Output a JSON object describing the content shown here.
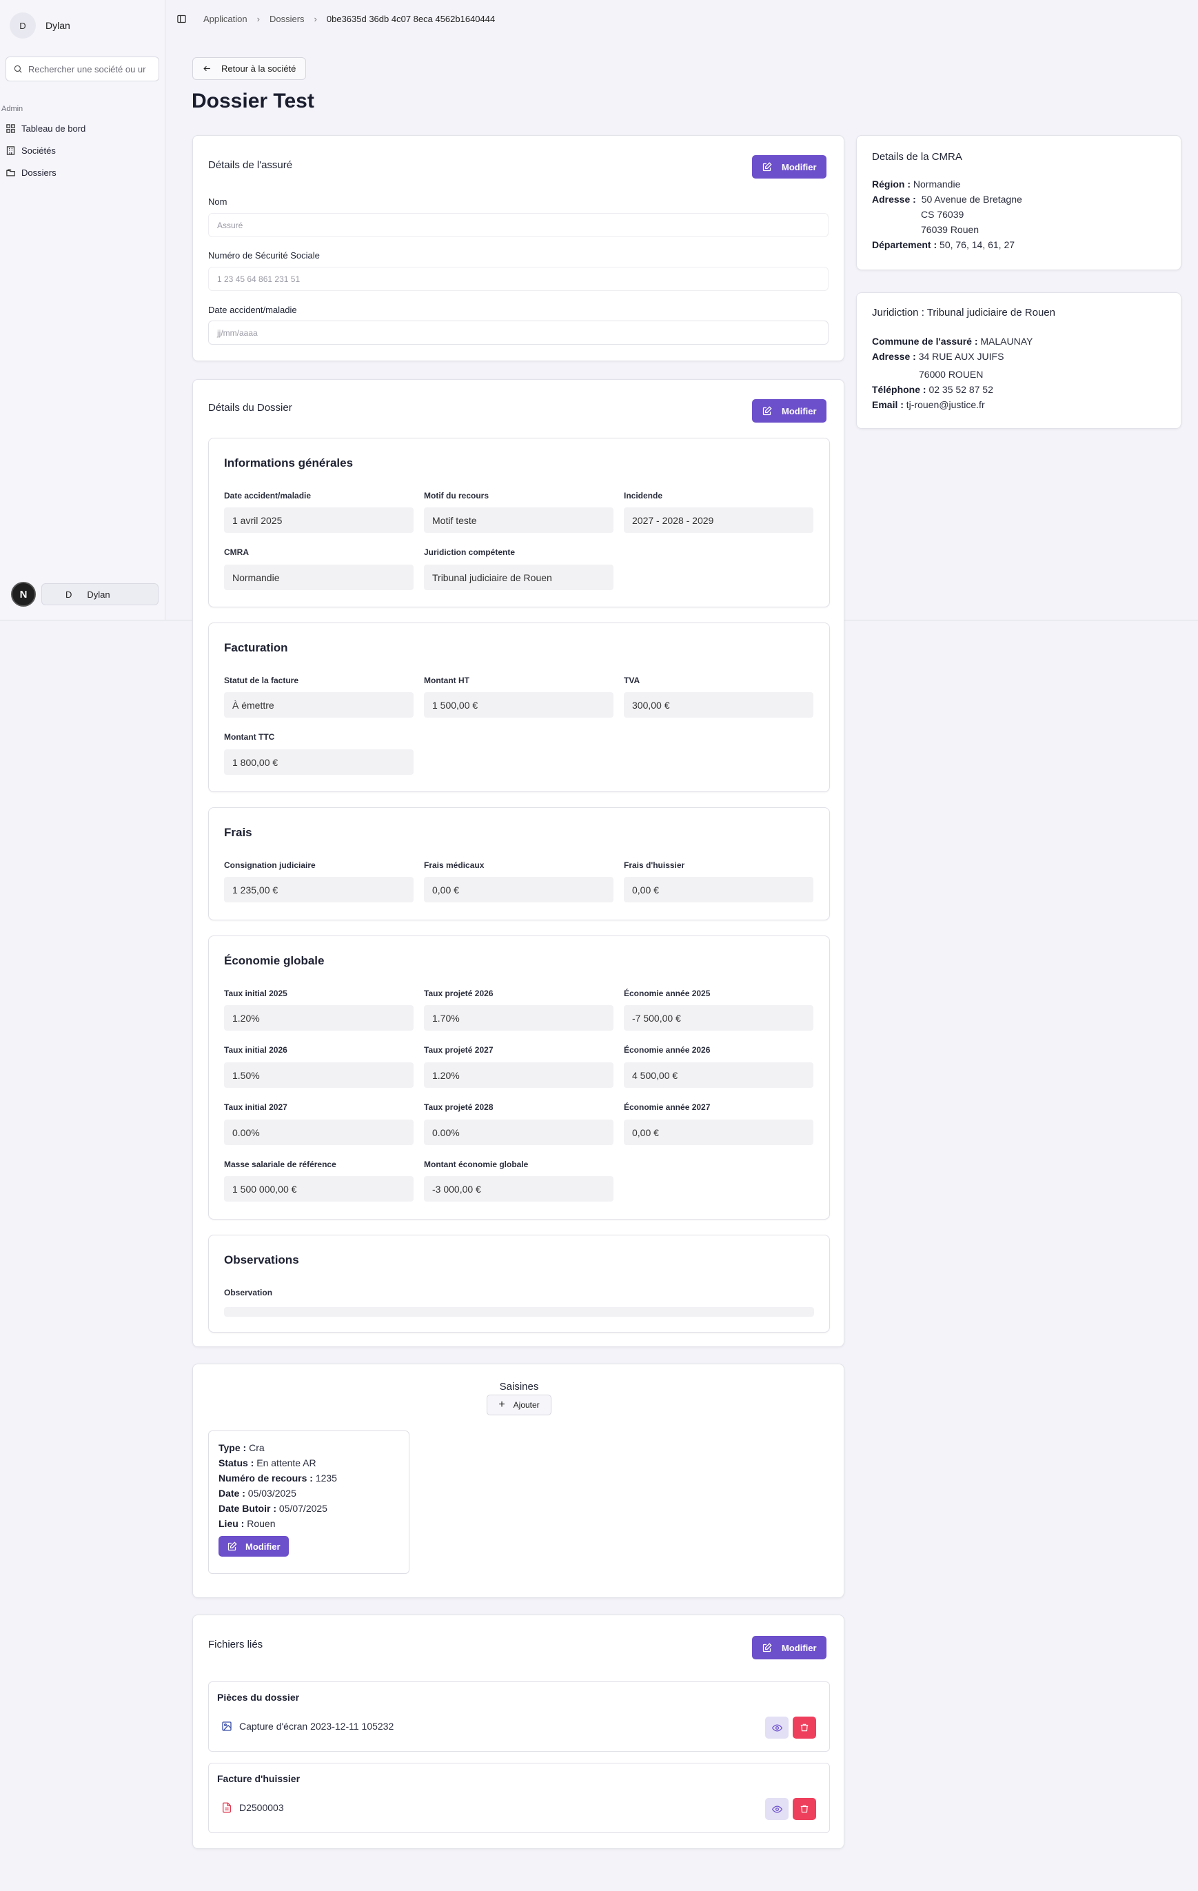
{
  "sidebar": {
    "user_initial": "D",
    "user_name": "Dylan",
    "search_placeholder": "Rechercher une société ou ur",
    "section_title": "Admin",
    "items": [
      {
        "label": "Tableau de bord",
        "icon": "dashboard-icon"
      },
      {
        "label": "Sociétés",
        "icon": "building-icon"
      },
      {
        "label": "Dossiers",
        "icon": "folders-icon"
      }
    ],
    "footer_badge": "N",
    "footer_initial": "D",
    "footer_name": "Dylan"
  },
  "breadcrumb": [
    "Application",
    "Dossiers",
    "0be3635d 36db 4c07 8eca 4562b1640444"
  ],
  "back_button": "Retour à la société",
  "page_title": "Dossier Test",
  "modify_label": "Modifier",
  "assure": {
    "title": "Détails de l'assuré",
    "fields": [
      {
        "label": "Nom",
        "placeholder": "Assuré"
      },
      {
        "label": "Numéro de Sécurité Sociale",
        "placeholder": "1 23 45 64 861 231 51"
      },
      {
        "label": "Date accident/maladie",
        "placeholder": "jj/mm/aaaa"
      }
    ]
  },
  "dossier": {
    "title": "Détails du Dossier",
    "generales": {
      "title": "Informations générales",
      "fields": [
        {
          "label": "Date accident/maladie",
          "value": "1 avril 2025"
        },
        {
          "label": "Motif du recours",
          "value": "Motif teste"
        },
        {
          "label": "Incidende",
          "value": "2027 - 2028 - 2029"
        },
        {
          "label": "CMRA",
          "value": "Normandie"
        },
        {
          "label": "Juridiction compétente",
          "value": "Tribunal judiciaire de Rouen"
        }
      ]
    },
    "facturation": {
      "title": "Facturation",
      "fields": [
        {
          "label": "Statut de la facture",
          "value": "À émettre"
        },
        {
          "label": "Montant HT",
          "value": "1 500,00 €"
        },
        {
          "label": "TVA",
          "value": "300,00 €"
        },
        {
          "label": "Montant TTC",
          "value": "1 800,00 €"
        }
      ]
    },
    "frais": {
      "title": "Frais",
      "fields": [
        {
          "label": "Consignation judiciaire",
          "value": "1 235,00 €"
        },
        {
          "label": "Frais médicaux",
          "value": "0,00 €"
        },
        {
          "label": "Frais d'huissier",
          "value": "0,00 €"
        }
      ]
    },
    "economie": {
      "title": "Économie globale",
      "fields": [
        {
          "label": "Taux initial 2025",
          "value": "1.20%"
        },
        {
          "label": "Taux projeté 2026",
          "value": "1.70%"
        },
        {
          "label": "Économie année 2025",
          "value": "-7 500,00 €"
        },
        {
          "label": "Taux initial 2026",
          "value": "1.50%"
        },
        {
          "label": "Taux projeté 2027",
          "value": "1.20%"
        },
        {
          "label": "Économie année 2026",
          "value": "4 500,00 €"
        },
        {
          "label": "Taux initial 2027",
          "value": "0.00%"
        },
        {
          "label": "Taux projeté 2028",
          "value": "0.00%"
        },
        {
          "label": "Économie année 2027",
          "value": "0,00 €"
        },
        {
          "label": "Masse salariale de référence",
          "value": "1 500 000,00 €"
        },
        {
          "label": "Montant économie globale",
          "value": "-3 000,00 €"
        }
      ]
    },
    "observations": {
      "title": "Observations",
      "label": "Observation",
      "value": ""
    }
  },
  "saisines": {
    "title": "Saisines",
    "add_label": "Ajouter",
    "item": {
      "type_label": "Type :",
      "type_value": "Cra",
      "status_label": "Status :",
      "status_value": "En attente AR",
      "numero_label": "Numéro de recours :",
      "numero_value": "1235",
      "date_label": "Date :",
      "date_value": "05/03/2025",
      "butoir_label": "Date Butoir :",
      "butoir_value": "05/07/2025",
      "lieu_label": "Lieu :",
      "lieu_value": "Rouen"
    }
  },
  "fichiers": {
    "title": "Fichiers liés",
    "groups": [
      {
        "title": "Pièces du dossier",
        "file": "Capture d'écran 2023-12-11 105232",
        "icon": "image-file-icon"
      },
      {
        "title": "Facture d'huissier",
        "file": "D2500003",
        "icon": "pdf-file-icon"
      }
    ]
  },
  "cmra": {
    "title": "Details de la CMRA",
    "region_label": "Région :",
    "region_value": "Normandie",
    "adresse_label": "Adresse :",
    "adresse_1": "50 Avenue de Bretagne",
    "adresse_2": "CS 76039",
    "adresse_3": "76039 Rouen",
    "dept_label": "Département :",
    "dept_value": "50, 76, 14, 61, 27"
  },
  "juridiction": {
    "title": "Juridiction : Tribunal judiciaire de Rouen",
    "commune_label": "Commune de l'assuré :",
    "commune_value": "MALAUNAY",
    "adresse_label": "Adresse :",
    "adresse_1": "34 RUE AUX JUIFS",
    "adresse_2": "76000 ROUEN",
    "tel_label": "Téléphone :",
    "tel_value": "02 35 52 87 52",
    "email_label": "Email :",
    "email_value": "tj-rouen@justice.fr"
  },
  "colors": {
    "accent": "#6c4fcb",
    "danger": "#ee3f5c",
    "page_bg": "#f3f3f9"
  }
}
